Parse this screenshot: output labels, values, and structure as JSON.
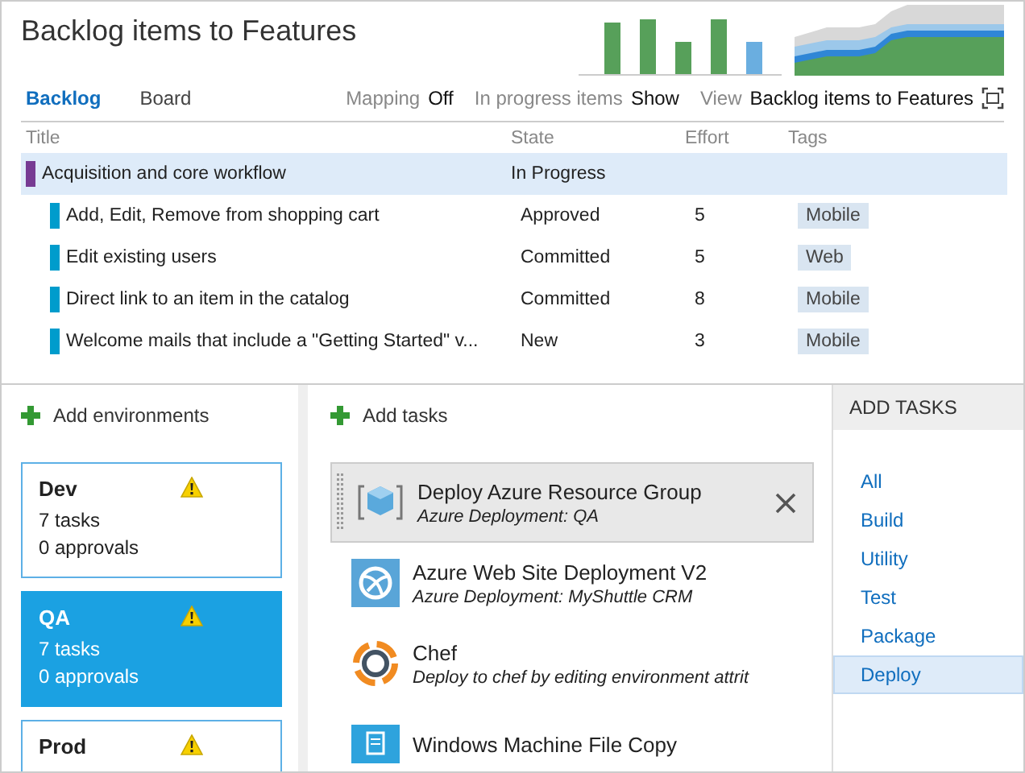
{
  "title": "Backlog items to Features",
  "tabs": [
    {
      "label": "Backlog",
      "selected": true
    },
    {
      "label": "Board",
      "selected": false
    }
  ],
  "options": [
    {
      "label": "Mapping",
      "value": "Off"
    },
    {
      "label": "In progress items",
      "value": "Show"
    },
    {
      "label": "View",
      "value": "Backlog items to Features"
    }
  ],
  "table": {
    "columns": [
      "Title",
      "State",
      "Effort",
      "Tags"
    ],
    "rows": [
      {
        "title": "Acquisition and core workflow",
        "state": "In Progress",
        "color": "#773b93",
        "selected": true,
        "children": [
          {
            "title": "Add, Edit, Remove from shopping cart",
            "state": "Approved",
            "effort": "5",
            "tag": "Mobile",
            "color": "#009ccc",
            "selected": false
          },
          {
            "title": "Edit existing users",
            "state": "Committed",
            "effort": "5",
            "tag": "Web",
            "color": "#009ccc",
            "selected": false
          },
          {
            "title": "Direct link to an item in the catalog",
            "state": "Committed",
            "effort": "8",
            "tag": "Mobile",
            "color": "#009ccc",
            "selected": false
          },
          {
            "title": "Welcome mails that include a \"Getting Started\" v...",
            "state": "New",
            "effort": "3",
            "tag": "Mobile",
            "color": "#009ccc",
            "selected": false
          }
        ]
      }
    ]
  },
  "environments": {
    "add_label": "Add environments",
    "items": [
      {
        "name": "Dev",
        "tasks": "7 tasks",
        "approvals": "0 approvals",
        "selected": false
      },
      {
        "name": "QA",
        "tasks": "7 tasks",
        "approvals": "0 approvals",
        "selected": true
      },
      {
        "name": "Prod",
        "selected": false
      }
    ]
  },
  "tasks": {
    "add_label": "Add tasks",
    "items": [
      {
        "kind": "resource-group",
        "name": "Deploy Azure Resource Group",
        "detail": "Azure Deployment: QA",
        "selected": true
      },
      {
        "kind": "web-site",
        "name": "Azure Web Site Deployment V2",
        "detail": "Azure Deployment: MyShuttle CRM",
        "selected": false
      },
      {
        "kind": "chef",
        "name": "Chef",
        "detail": "Deploy to chef by editing environment attrit",
        "selected": false
      },
      {
        "kind": "file-copy",
        "name": "Windows Machine File Copy",
        "selected": false
      }
    ]
  },
  "add_tasks": {
    "heading": "ADD TASKS",
    "categories": [
      {
        "label": "All",
        "selected": false
      },
      {
        "label": "Build",
        "selected": false
      },
      {
        "label": "Utility",
        "selected": false
      },
      {
        "label": "Test",
        "selected": false
      },
      {
        "label": "Package",
        "selected": false
      },
      {
        "label": "Deploy",
        "selected": true
      }
    ]
  }
}
